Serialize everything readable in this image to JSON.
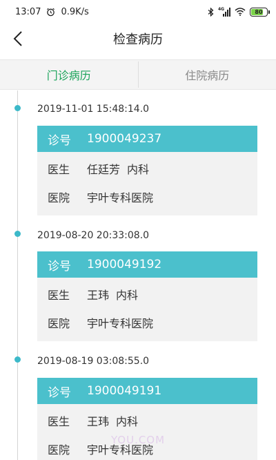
{
  "status_bar": {
    "time": "13:07",
    "speed": "0.9K/s",
    "network": "4G",
    "battery": "80",
    "battery_level_percent": 80
  },
  "header": {
    "title": "检查病历"
  },
  "tabs": [
    {
      "label": "门诊病历",
      "active": true
    },
    {
      "label": "住院病历",
      "active": false
    }
  ],
  "records": [
    {
      "datetime": "2019-11-01 15:48:14.0",
      "visit_label": "诊号",
      "visit_no": "1900049237",
      "doctor_label": "医生",
      "doctor": "任廷芳",
      "department": "内科",
      "hospital_label": "医院",
      "hospital": "宇叶专科医院"
    },
    {
      "datetime": "2019-08-20 20:33:08.0",
      "visit_label": "诊号",
      "visit_no": "1900049192",
      "doctor_label": "医生",
      "doctor": "王玮",
      "department": "内科",
      "hospital_label": "医院",
      "hospital": "宇叶专科医院"
    },
    {
      "datetime": "2019-08-19 03:08:55.0",
      "visit_label": "诊号",
      "visit_no": "1900049191",
      "doctor_label": "医生",
      "doctor": "王玮",
      "department": "内科",
      "hospital_label": "医院",
      "hospital": "宇叶专科医院"
    }
  ],
  "watermark": "YOU.COM",
  "colors": {
    "accent": "#4bc0cc",
    "active_tab": "#1aa35a",
    "timeline_dot": "#3cb9c9",
    "battery": "#7bd34a"
  }
}
